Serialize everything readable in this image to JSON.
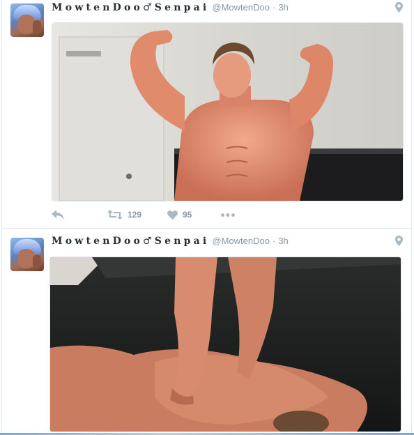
{
  "tweets": [
    {
      "display_name": "MowtenDoo♂Senpai",
      "handle": "@MowtenDoo",
      "separator": "·",
      "time": "3h",
      "retweet_count": "129",
      "like_count": "95"
    },
    {
      "display_name": "MowtenDoo♂Senpai",
      "handle": "@MowtenDoo",
      "separator": "·",
      "time": "3h"
    }
  ],
  "icons": {
    "geo": "location-pin-icon",
    "reply": "reply-icon",
    "retweet": "retweet-icon",
    "like": "heart-icon",
    "more": "more-dots-icon"
  },
  "colors": {
    "name": "#292f33",
    "meta": "#8899a6",
    "action_icon": "#aab8c2",
    "divider": "#e1e8ed"
  }
}
